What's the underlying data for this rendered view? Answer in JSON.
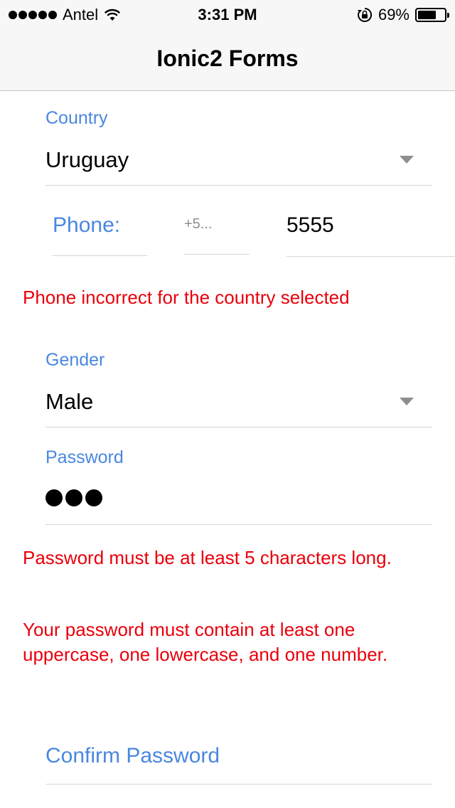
{
  "status_bar": {
    "carrier": "Antel",
    "time": "3:31 PM",
    "battery_percent": "69%",
    "battery_level": 0.69,
    "icons": [
      "signal-dots-icon",
      "wifi-icon",
      "rotation-lock-icon",
      "battery-icon"
    ]
  },
  "header": {
    "title": "Ionic2 Forms"
  },
  "form": {
    "country": {
      "label": "Country",
      "value": "Uruguay"
    },
    "phone": {
      "label": "Phone:",
      "code": "+5...",
      "number": "5555"
    },
    "phone_error": "Phone incorrect for the country selected",
    "gender": {
      "label": "Gender",
      "value": "Male"
    },
    "password": {
      "label": "Password",
      "masked_length": 3
    },
    "password_errors": [
      "Password must be at least 5 characters long.",
      "Your password must contain at least one uppercase, one lowercase, and one number."
    ],
    "confirm_password": {
      "label": "Confirm Password"
    }
  },
  "colors": {
    "label": "#4a87e0",
    "error": "#e8000b",
    "divider": "#d6d6d6"
  }
}
